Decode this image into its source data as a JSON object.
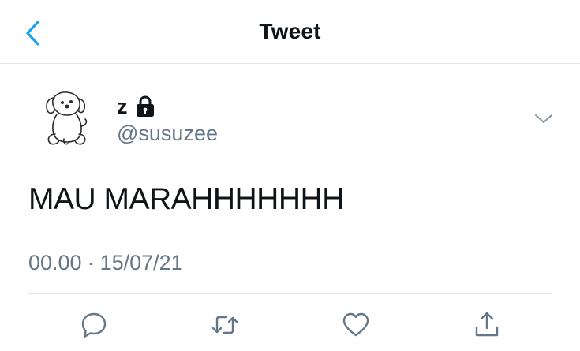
{
  "header": {
    "title": "Tweet",
    "back_icon": "chevron-left-icon"
  },
  "tweet": {
    "display_name": "z",
    "protected_icon": "lock-icon",
    "handle": "@susuzee",
    "text": "MAU MARAHHHHHHH",
    "time": "00.00",
    "separator": "·",
    "date": "15/07/21"
  },
  "actions": [
    {
      "name": "reply",
      "icon": "reply-icon"
    },
    {
      "name": "retweet",
      "icon": "retweet-icon"
    },
    {
      "name": "like",
      "icon": "heart-icon"
    },
    {
      "name": "share",
      "icon": "share-icon"
    }
  ],
  "colors": {
    "accent": "#1da1f2",
    "text_primary": "#0f1419",
    "text_secondary": "#657786",
    "divider": "#e1e4e8"
  }
}
